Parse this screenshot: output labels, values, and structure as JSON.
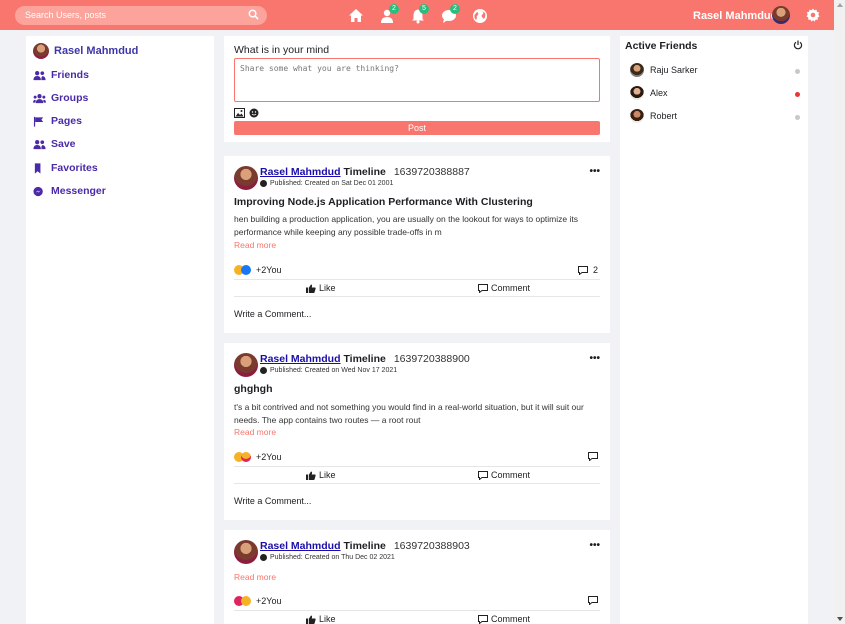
{
  "search": {
    "placeholder": "Search Users, posts"
  },
  "topbar": {
    "username": "Rasel Mahmdud",
    "badges": {
      "friends": "2",
      "notifications": "5",
      "messages": "2"
    },
    "accent": "#f8766d"
  },
  "sidebar": {
    "user": "Rasel Mahmdud",
    "items": [
      {
        "label": "Friends",
        "icon": "users-icon"
      },
      {
        "label": "Groups",
        "icon": "group-icon"
      },
      {
        "label": "Pages",
        "icon": "flag-icon"
      },
      {
        "label": "Save",
        "icon": "users-icon"
      },
      {
        "label": "Favorites",
        "icon": "bookmark-icon"
      },
      {
        "label": "Messenger",
        "icon": "messenger-icon"
      }
    ]
  },
  "composer": {
    "title": "What is in your mind",
    "placeholder": "Share some what you are thinking?",
    "post_label": "Post"
  },
  "posts": [
    {
      "author": "Rasel Mahmdud",
      "timeline": "Timeline",
      "id": "1639720388887",
      "published": "Published: Created on Sat Dec 01 2001",
      "title": "Improving Node.js Application Performance With Clustering",
      "text": "hen building a production application, you are usually on the lookout for ways to optimize its performance while keeping any possible trade-offs in m",
      "read_more": "Read more",
      "reactions": "+2You",
      "comments": "2",
      "like": "Like",
      "comment": "Comment",
      "write": "Write a Comment..."
    },
    {
      "author": "Rasel Mahmdud",
      "timeline": "Timeline",
      "id": "1639720388900",
      "published": "Published: Created on Wed Nov 17 2021",
      "title": "ghghgh",
      "text": "t's a bit contrived and not something you would find in a real-world situation, but it will suit our needs. The app contains two routes — a root rout",
      "read_more": "Read more",
      "reactions": "+2You",
      "like": "Like",
      "comment": "Comment",
      "write": "Write a Comment..."
    },
    {
      "author": "Rasel Mahmdud",
      "timeline": "Timeline",
      "id": "1639720388903",
      "published": "Published: Created on Thu Dec 02 2021",
      "read_more": "Read more",
      "reactions": "+2You",
      "like": "Like",
      "comment": "Comment"
    }
  ],
  "active_friends": {
    "title": "Active Friends",
    "friends": [
      {
        "name": "Raju Sarker",
        "status_color": "#c8c8c8"
      },
      {
        "name": "Alex",
        "status_color": "#e53935"
      },
      {
        "name": "Robert",
        "status_color": "#c8c8c8"
      }
    ]
  }
}
